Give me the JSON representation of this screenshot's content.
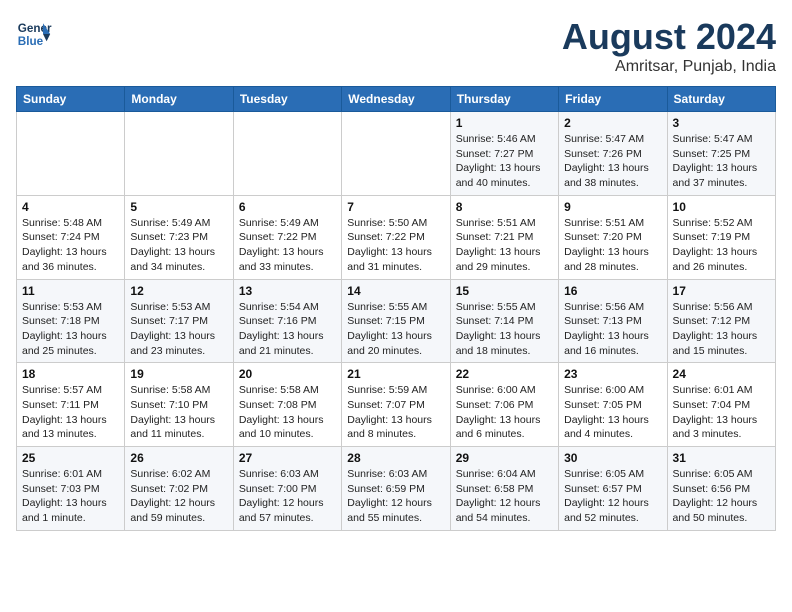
{
  "header": {
    "logo_line1": "General",
    "logo_line2": "Blue",
    "month_year": "August 2024",
    "location": "Amritsar, Punjab, India"
  },
  "weekdays": [
    "Sunday",
    "Monday",
    "Tuesday",
    "Wednesday",
    "Thursday",
    "Friday",
    "Saturday"
  ],
  "weeks": [
    [
      {
        "day": "",
        "info": ""
      },
      {
        "day": "",
        "info": ""
      },
      {
        "day": "",
        "info": ""
      },
      {
        "day": "",
        "info": ""
      },
      {
        "day": "1",
        "info": "Sunrise: 5:46 AM\nSunset: 7:27 PM\nDaylight: 13 hours and 40 minutes."
      },
      {
        "day": "2",
        "info": "Sunrise: 5:47 AM\nSunset: 7:26 PM\nDaylight: 13 hours and 38 minutes."
      },
      {
        "day": "3",
        "info": "Sunrise: 5:47 AM\nSunset: 7:25 PM\nDaylight: 13 hours and 37 minutes."
      }
    ],
    [
      {
        "day": "4",
        "info": "Sunrise: 5:48 AM\nSunset: 7:24 PM\nDaylight: 13 hours and 36 minutes."
      },
      {
        "day": "5",
        "info": "Sunrise: 5:49 AM\nSunset: 7:23 PM\nDaylight: 13 hours and 34 minutes."
      },
      {
        "day": "6",
        "info": "Sunrise: 5:49 AM\nSunset: 7:22 PM\nDaylight: 13 hours and 33 minutes."
      },
      {
        "day": "7",
        "info": "Sunrise: 5:50 AM\nSunset: 7:22 PM\nDaylight: 13 hours and 31 minutes."
      },
      {
        "day": "8",
        "info": "Sunrise: 5:51 AM\nSunset: 7:21 PM\nDaylight: 13 hours and 29 minutes."
      },
      {
        "day": "9",
        "info": "Sunrise: 5:51 AM\nSunset: 7:20 PM\nDaylight: 13 hours and 28 minutes."
      },
      {
        "day": "10",
        "info": "Sunrise: 5:52 AM\nSunset: 7:19 PM\nDaylight: 13 hours and 26 minutes."
      }
    ],
    [
      {
        "day": "11",
        "info": "Sunrise: 5:53 AM\nSunset: 7:18 PM\nDaylight: 13 hours and 25 minutes."
      },
      {
        "day": "12",
        "info": "Sunrise: 5:53 AM\nSunset: 7:17 PM\nDaylight: 13 hours and 23 minutes."
      },
      {
        "day": "13",
        "info": "Sunrise: 5:54 AM\nSunset: 7:16 PM\nDaylight: 13 hours and 21 minutes."
      },
      {
        "day": "14",
        "info": "Sunrise: 5:55 AM\nSunset: 7:15 PM\nDaylight: 13 hours and 20 minutes."
      },
      {
        "day": "15",
        "info": "Sunrise: 5:55 AM\nSunset: 7:14 PM\nDaylight: 13 hours and 18 minutes."
      },
      {
        "day": "16",
        "info": "Sunrise: 5:56 AM\nSunset: 7:13 PM\nDaylight: 13 hours and 16 minutes."
      },
      {
        "day": "17",
        "info": "Sunrise: 5:56 AM\nSunset: 7:12 PM\nDaylight: 13 hours and 15 minutes."
      }
    ],
    [
      {
        "day": "18",
        "info": "Sunrise: 5:57 AM\nSunset: 7:11 PM\nDaylight: 13 hours and 13 minutes."
      },
      {
        "day": "19",
        "info": "Sunrise: 5:58 AM\nSunset: 7:10 PM\nDaylight: 13 hours and 11 minutes."
      },
      {
        "day": "20",
        "info": "Sunrise: 5:58 AM\nSunset: 7:08 PM\nDaylight: 13 hours and 10 minutes."
      },
      {
        "day": "21",
        "info": "Sunrise: 5:59 AM\nSunset: 7:07 PM\nDaylight: 13 hours and 8 minutes."
      },
      {
        "day": "22",
        "info": "Sunrise: 6:00 AM\nSunset: 7:06 PM\nDaylight: 13 hours and 6 minutes."
      },
      {
        "day": "23",
        "info": "Sunrise: 6:00 AM\nSunset: 7:05 PM\nDaylight: 13 hours and 4 minutes."
      },
      {
        "day": "24",
        "info": "Sunrise: 6:01 AM\nSunset: 7:04 PM\nDaylight: 13 hours and 3 minutes."
      }
    ],
    [
      {
        "day": "25",
        "info": "Sunrise: 6:01 AM\nSunset: 7:03 PM\nDaylight: 13 hours and 1 minute."
      },
      {
        "day": "26",
        "info": "Sunrise: 6:02 AM\nSunset: 7:02 PM\nDaylight: 12 hours and 59 minutes."
      },
      {
        "day": "27",
        "info": "Sunrise: 6:03 AM\nSunset: 7:00 PM\nDaylight: 12 hours and 57 minutes."
      },
      {
        "day": "28",
        "info": "Sunrise: 6:03 AM\nSunset: 6:59 PM\nDaylight: 12 hours and 55 minutes."
      },
      {
        "day": "29",
        "info": "Sunrise: 6:04 AM\nSunset: 6:58 PM\nDaylight: 12 hours and 54 minutes."
      },
      {
        "day": "30",
        "info": "Sunrise: 6:05 AM\nSunset: 6:57 PM\nDaylight: 12 hours and 52 minutes."
      },
      {
        "day": "31",
        "info": "Sunrise: 6:05 AM\nSunset: 6:56 PM\nDaylight: 12 hours and 50 minutes."
      }
    ]
  ]
}
